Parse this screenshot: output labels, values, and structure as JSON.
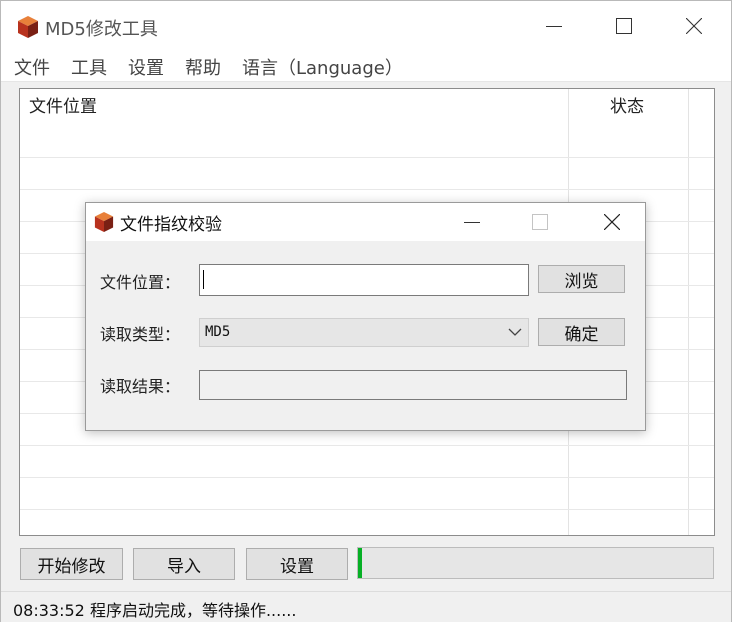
{
  "window": {
    "title": "MD5修改工具",
    "icon": "cube-icon"
  },
  "menu": [
    "文件",
    "工具",
    "设置",
    "帮助",
    "语言（Language）"
  ],
  "list": {
    "columns": [
      "文件位置",
      "状态"
    ],
    "rows": []
  },
  "buttons": {
    "start": "开始修改",
    "import": "导入",
    "settings": "设置"
  },
  "progress": {
    "value_percent": 1,
    "color": "#06b025"
  },
  "status": {
    "text": "08:33:52 程序启动完成，等待操作......"
  },
  "dialog": {
    "title": "文件指纹校验",
    "file_label": "文件位置：",
    "file_value": "",
    "browse": "浏览",
    "type_label": "读取类型：",
    "type_value": "MD5",
    "confirm": "确定",
    "result_label": "读取结果：",
    "result_value": ""
  }
}
